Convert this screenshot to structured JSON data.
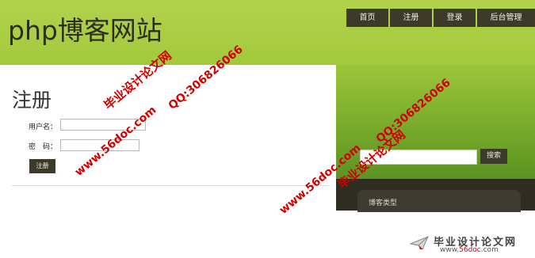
{
  "header": {
    "site_title": "php博客网站",
    "nav": [
      {
        "label": "首页"
      },
      {
        "label": "注册"
      },
      {
        "label": "登录"
      },
      {
        "label": "后台管理"
      }
    ]
  },
  "main": {
    "heading": "注册",
    "form": {
      "username_label": "用户名：",
      "password_label": "密　码：",
      "username_value": "",
      "password_value": "",
      "submit_label": "注册"
    }
  },
  "sidebar": {
    "search_value": "",
    "search_button": "搜索",
    "category_title": "博客类型"
  },
  "watermarks": {
    "url": "www.56doc.com",
    "site_name": "毕业设计论文网",
    "qq": "QQ:306826066"
  },
  "footer_logo": {
    "name": "毕业设计论文网",
    "url_prefix": "www.",
    "url_domain": "56doc",
    "url_suffix": ".com"
  },
  "colors": {
    "header_green": "#a3c93c",
    "nav_dark": "#3d3a2a",
    "watermark_red": "#d10000"
  }
}
